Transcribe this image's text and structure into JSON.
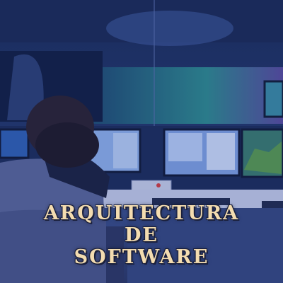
{
  "title": {
    "line1": "ARQUITECTURA",
    "line2": "DE",
    "line3": "SOFTWARE"
  },
  "colors": {
    "title_text": "#f3dcb0",
    "overlay_blue": "#1e3a8a"
  }
}
